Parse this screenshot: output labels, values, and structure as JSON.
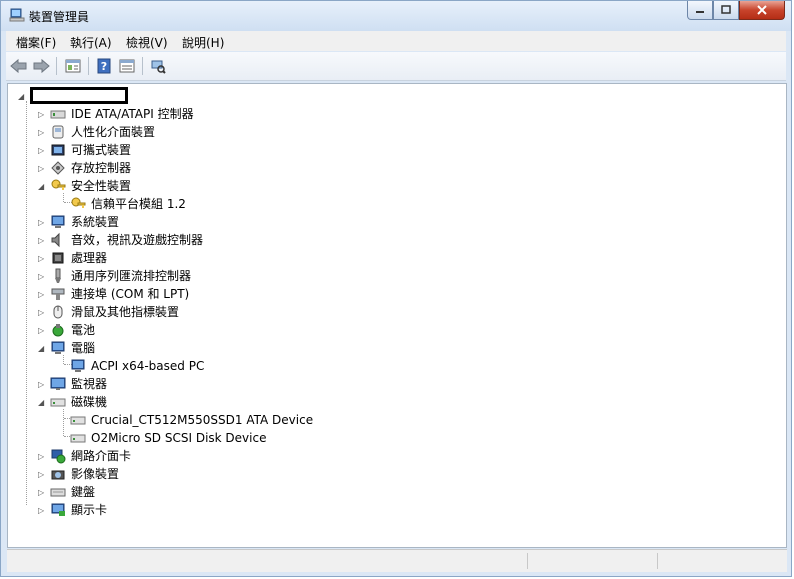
{
  "window": {
    "title": "裝置管理員"
  },
  "menu": [
    "檔案(F)",
    "執行(A)",
    "檢視(V)",
    "說明(H)"
  ],
  "toolbar": [
    "back-icon",
    "forward-icon",
    "properties-view-icon",
    "help-icon",
    "device-view-icon",
    "scan-hardware-icon"
  ],
  "tree": [
    {
      "label": "",
      "icon": "computer-redacted",
      "level": 0,
      "expander": "open"
    },
    {
      "label": "IDE ATA/ATAPI 控制器",
      "icon": "ide-controller-icon",
      "level": 1,
      "expander": "closed"
    },
    {
      "label": "人性化介面裝置",
      "icon": "hid-icon",
      "level": 1,
      "expander": "closed"
    },
    {
      "label": "可攜式裝置",
      "icon": "portable-device-icon",
      "level": 1,
      "expander": "closed"
    },
    {
      "label": "存放控制器",
      "icon": "storage-controller-icon",
      "level": 1,
      "expander": "closed"
    },
    {
      "label": "安全性裝置",
      "icon": "security-key-icon",
      "level": 1,
      "expander": "open"
    },
    {
      "label": "信賴平台模組 1.2",
      "icon": "security-key-icon",
      "level": 2,
      "expander": "none"
    },
    {
      "label": "系統裝置",
      "icon": "system-device-icon",
      "level": 1,
      "expander": "closed"
    },
    {
      "label": "音效，視訊及遊戲控制器",
      "icon": "speaker-icon",
      "level": 1,
      "expander": "closed"
    },
    {
      "label": "處理器",
      "icon": "processor-icon",
      "level": 1,
      "expander": "closed"
    },
    {
      "label": "通用序列匯流排控制器",
      "icon": "usb-icon",
      "level": 1,
      "expander": "closed"
    },
    {
      "label": "連接埠 (COM 和 LPT)",
      "icon": "port-icon",
      "level": 1,
      "expander": "closed"
    },
    {
      "label": "滑鼠及其他指標裝置",
      "icon": "mouse-icon",
      "level": 1,
      "expander": "closed"
    },
    {
      "label": "電池",
      "icon": "battery-icon",
      "level": 1,
      "expander": "closed"
    },
    {
      "label": "電腦",
      "icon": "computer-icon",
      "level": 1,
      "expander": "open"
    },
    {
      "label": "ACPI x64-based PC",
      "icon": "computer-icon",
      "level": 2,
      "expander": "none"
    },
    {
      "label": "監視器",
      "icon": "monitor-icon",
      "level": 1,
      "expander": "closed"
    },
    {
      "label": "磁碟機",
      "icon": "disk-drive-icon",
      "level": 1,
      "expander": "open"
    },
    {
      "label": "Crucial_CT512M550SSD1 ATA Device",
      "icon": "disk-drive-icon",
      "level": 2,
      "expander": "none"
    },
    {
      "label": "O2Micro SD SCSI Disk Device",
      "icon": "disk-drive-icon",
      "level": 2,
      "expander": "none"
    },
    {
      "label": "網路介面卡",
      "icon": "network-adapter-icon",
      "level": 1,
      "expander": "closed"
    },
    {
      "label": "影像裝置",
      "icon": "camera-icon",
      "level": 1,
      "expander": "closed"
    },
    {
      "label": "鍵盤",
      "icon": "keyboard-icon",
      "level": 1,
      "expander": "closed"
    },
    {
      "label": "顯示卡",
      "icon": "display-adapter-icon",
      "level": 1,
      "expander": "closed"
    }
  ]
}
